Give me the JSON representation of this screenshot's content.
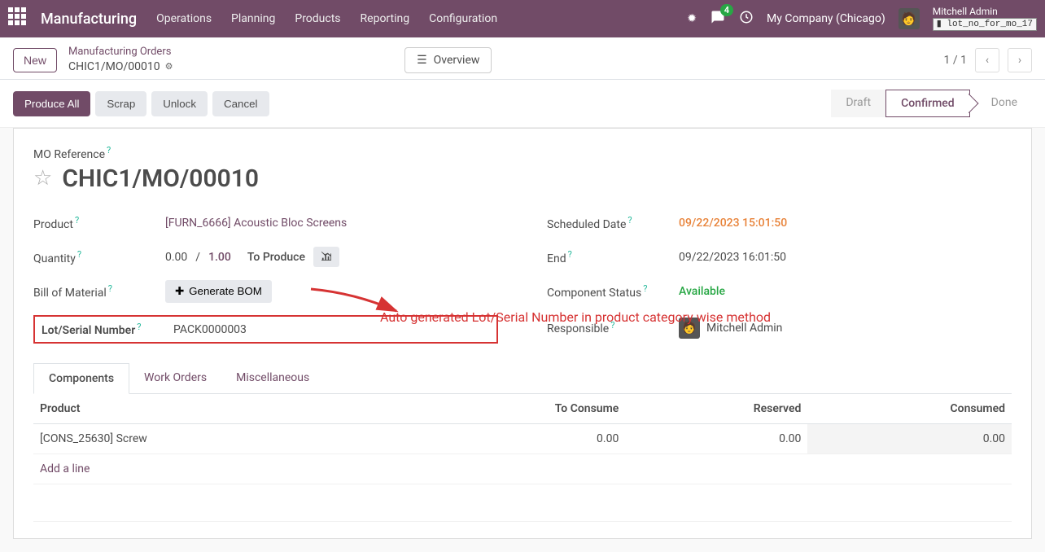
{
  "topbar": {
    "brand": "Manufacturing",
    "menu": [
      "Operations",
      "Planning",
      "Products",
      "Reporting",
      "Configuration"
    ],
    "chat_badge": "4",
    "company": "My Company (Chicago)",
    "user": "Mitchell Admin",
    "db_tag": "lot_no_for_mo_17"
  },
  "subhead": {
    "new_btn": "New",
    "crumb_parent": "Manufacturing Orders",
    "crumb_current": "CHIC1/MO/00010",
    "overview": "Overview",
    "pager": "1 / 1"
  },
  "actions": {
    "produce_all": "Produce All",
    "scrap": "Scrap",
    "unlock": "Unlock",
    "cancel": "Cancel"
  },
  "status": {
    "draft": "Draft",
    "confirmed": "Confirmed",
    "done": "Done"
  },
  "sheet": {
    "mo_ref_lbl": "MO Reference",
    "mo_ref": "CHIC1/MO/00010",
    "product_lbl": "Product",
    "product": "[FURN_6666] Acoustic Bloc Screens",
    "qty_lbl": "Quantity",
    "qty_done": "0.00",
    "qty_sep": "/",
    "qty_total": "1.00",
    "to_produce": "To Produce",
    "bom_lbl": "Bill of Material",
    "gen_bom": "Generate BOM",
    "lot_lbl": "Lot/Serial Number",
    "lot_val": "PACK0000003",
    "sched_lbl": "Scheduled Date",
    "sched_val": "09/22/2023 15:01:50",
    "end_lbl": "End",
    "end_val": "09/22/2023 16:01:50",
    "comp_status_lbl": "Component Status",
    "comp_status_val": "Available",
    "resp_lbl": "Responsible",
    "resp_val": "Mitchell Admin"
  },
  "annotation": "Auto generated Lot/Serial Number in product category wise method",
  "tabs": {
    "components": "Components",
    "work_orders": "Work Orders",
    "misc": "Miscellaneous"
  },
  "table": {
    "head": {
      "product": "Product",
      "to_consume": "To Consume",
      "reserved": "Reserved",
      "consumed": "Consumed"
    },
    "rows": [
      {
        "product": "[CONS_25630] Screw",
        "to_consume": "0.00",
        "reserved": "0.00",
        "consumed": "0.00"
      }
    ],
    "add_line": "Add a line"
  }
}
